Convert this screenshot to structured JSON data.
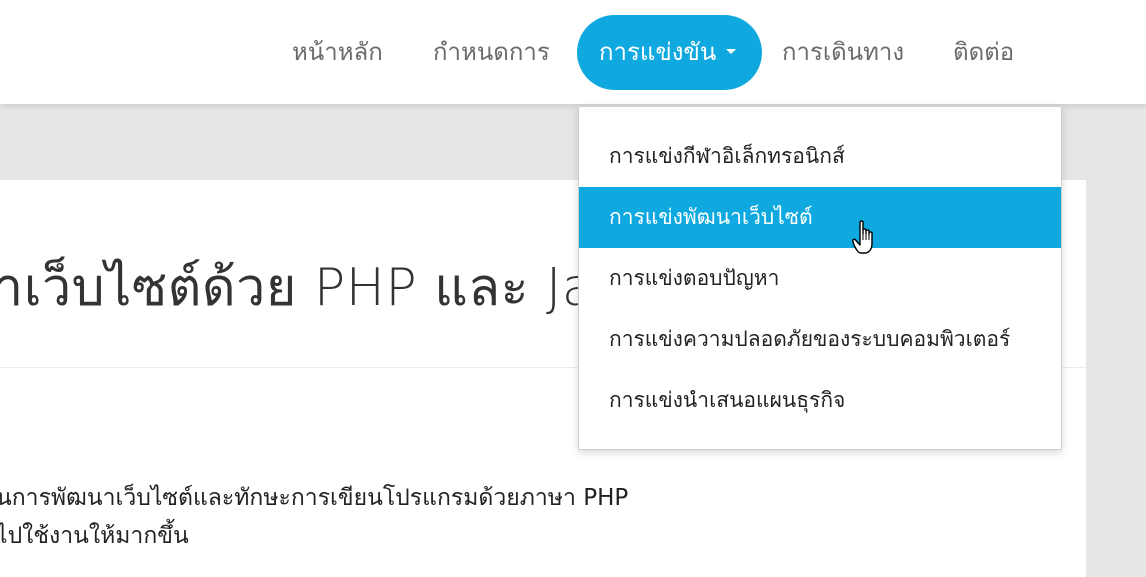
{
  "navbar": {
    "items": [
      {
        "label": "หน้าหลัก",
        "active": false
      },
      {
        "label": "กำหนดการ",
        "active": false
      },
      {
        "label": "การแข่งขัน",
        "active": true,
        "has_dropdown": true
      },
      {
        "label": "การเดินทาง",
        "active": false
      },
      {
        "label": "ติดต่อ",
        "active": false
      }
    ]
  },
  "dropdown": {
    "items": [
      {
        "label": "การแข่งกีฬาอิเล็กทรอนิกส์",
        "active": false
      },
      {
        "label": "การแข่งพัฒนาเว็บไซต์",
        "active": true
      },
      {
        "label": "การแข่งตอบปัญหา",
        "active": false
      },
      {
        "label": "การแข่งความปลอดภัยของระบบคอมพิวเตอร์",
        "active": false
      },
      {
        "label": "การแข่งนำเสนอแผนธุรกิจ",
        "active": false
      }
    ]
  },
  "main": {
    "heading": "าเว็บไซต์ด้วย PHP และ JavaS",
    "body_lines": [
      "นการพัฒนาเว็บไซต์และทักษะการเขียนโปรแกรมด้วยภาษา PHP",
      "ไปใช้งานให้มากขึ้น"
    ]
  },
  "colors": {
    "accent": "#0fa9e0",
    "nav_text": "#6b6b6b",
    "page_background": "#e6e6e6"
  },
  "icons": {
    "cursor": "hand-pointer-icon",
    "caret": "caret-down-icon"
  }
}
